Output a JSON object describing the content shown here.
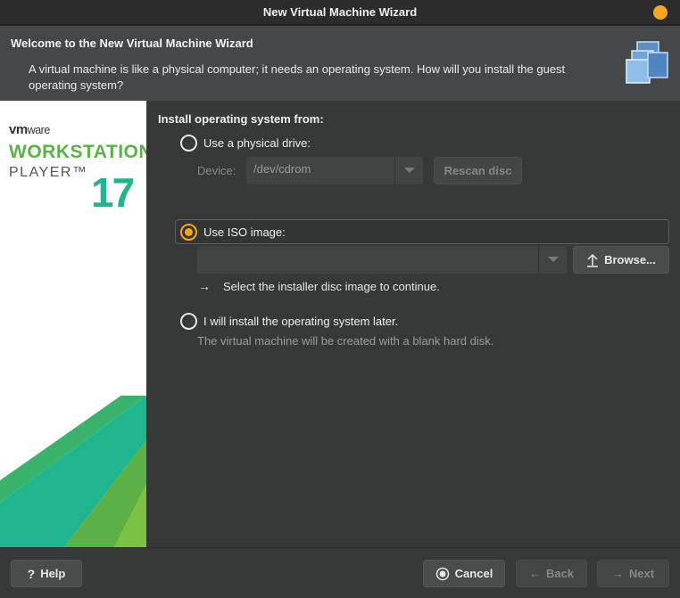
{
  "window": {
    "title": "New Virtual Machine Wizard"
  },
  "header": {
    "title": "Welcome to the New Virtual Machine Wizard",
    "description": "A virtual machine is like a physical computer; it needs an operating system. How will you install the guest operating system?",
    "icon": "stacked-windows-icon"
  },
  "brand": {
    "vendor": "vm",
    "vendor_suffix": "ware",
    "product": "WORKSTATION",
    "edition": "PLAYER™",
    "version": "17"
  },
  "install": {
    "section_title": "Install operating system from:",
    "physical_drive": {
      "label": "Use a physical drive:",
      "selected": false,
      "device_label": "Device:",
      "device_value": "/dev/cdrom",
      "rescan_label": "Rescan disc"
    },
    "iso_image": {
      "label": "Use ISO image:",
      "selected": true,
      "path_value": "",
      "browse_label": "Browse...",
      "hint": "Select the installer disc image to continue."
    },
    "later": {
      "label": "I will install the operating system later.",
      "selected": false,
      "description": "The virtual machine will be created with a blank hard disk."
    }
  },
  "footer": {
    "help_label": "Help",
    "cancel_label": "Cancel",
    "back_label": "Back",
    "next_label": "Next"
  },
  "colors": {
    "accent": "#f5a623",
    "brand_green": "#5bb146",
    "brand_teal": "#1fb58f"
  }
}
